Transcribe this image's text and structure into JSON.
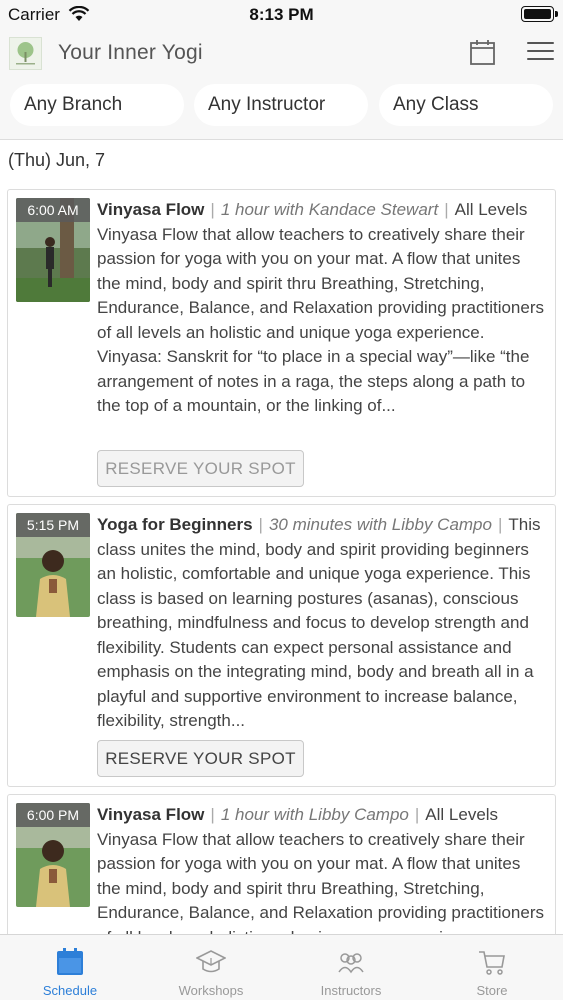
{
  "status_bar": {
    "carrier": "Carrier",
    "time": "8:13 PM"
  },
  "header": {
    "title": "Your Inner Yogi",
    "logo_icon": "tree-logo-icon",
    "calendar_icon": "calendar-icon",
    "menu_icon": "hamburger-menu-icon"
  },
  "filters": {
    "branch": "Any Branch",
    "instructor": "Any Instructor",
    "class": "Any Class"
  },
  "date_header": "(Thu) Jun, 7",
  "classes": [
    {
      "time": "6:00 AM",
      "name": "Vinyasa Flow",
      "meta": "1 hour with Kandace Stewart",
      "description": "All Levels Vinyasa Flow that allow teachers to creatively share their passion for yoga with you on your mat. A flow that unites the mind, body and spirit thru Breathing, Stretching, Endurance, Balance, and Relaxation providing practitioners of all levels an holistic and unique yoga experience. Vinyasa: Sanskrit for “to place in a special way”—like “the arrangement of notes in a raga, the steps along a path to the top of a mountain, or the linking of...",
      "button": "RESERVE YOUR SPOT"
    },
    {
      "time": "5:15 PM",
      "name": "Yoga for Beginners",
      "meta": "30 minutes with Libby Campo",
      "description": "This class unites the mind, body and spirit providing beginners an holistic, comfortable and unique yoga experience. This class is based on learning postures (asanas), conscious breathing, mindfulness and focus to develop strength and flexibility. Students can expect personal assistance and emphasis on the integrating mind, body and breath all in a playful and supportive environment to increase balance, flexibility, strength...",
      "button": "RESERVE YOUR SPOT"
    },
    {
      "time": "6:00 PM",
      "name": "Vinyasa Flow",
      "meta": "1 hour with Libby Campo",
      "description": "All Levels Vinyasa Flow that allow teachers to creatively share their passion for yoga with you on your mat. A flow that unites the mind, body and spirit thru Breathing, Stretching, Endurance, Balance, and Relaxation providing practitioners of all levels an holistic and unique yoga experience."
    }
  ],
  "tabs": [
    {
      "label": "Schedule",
      "icon": "calendar-icon",
      "active": true
    },
    {
      "label": "Workshops",
      "icon": "graduation-cap-icon",
      "active": false
    },
    {
      "label": "Instructors",
      "icon": "people-icon",
      "active": false
    },
    {
      "label": "Store",
      "icon": "shopping-cart-icon",
      "active": false
    }
  ],
  "colors": {
    "accent": "#2d7fd8",
    "bar_bg": "#f7f7f7"
  }
}
